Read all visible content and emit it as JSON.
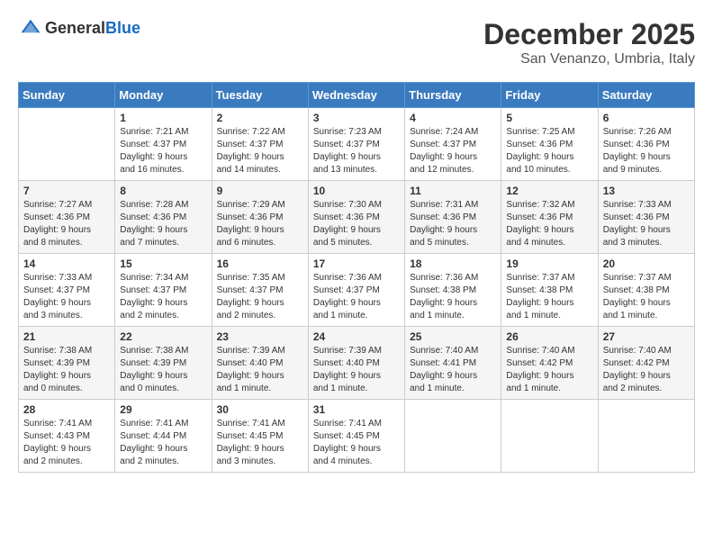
{
  "header": {
    "logo_general": "General",
    "logo_blue": "Blue",
    "month_title": "December 2025",
    "location": "San Venanzo, Umbria, Italy"
  },
  "weekdays": [
    "Sunday",
    "Monday",
    "Tuesday",
    "Wednesday",
    "Thursday",
    "Friday",
    "Saturday"
  ],
  "weeks": [
    [
      {
        "day": "",
        "info": ""
      },
      {
        "day": "1",
        "info": "Sunrise: 7:21 AM\nSunset: 4:37 PM\nDaylight: 9 hours\nand 16 minutes."
      },
      {
        "day": "2",
        "info": "Sunrise: 7:22 AM\nSunset: 4:37 PM\nDaylight: 9 hours\nand 14 minutes."
      },
      {
        "day": "3",
        "info": "Sunrise: 7:23 AM\nSunset: 4:37 PM\nDaylight: 9 hours\nand 13 minutes."
      },
      {
        "day": "4",
        "info": "Sunrise: 7:24 AM\nSunset: 4:37 PM\nDaylight: 9 hours\nand 12 minutes."
      },
      {
        "day": "5",
        "info": "Sunrise: 7:25 AM\nSunset: 4:36 PM\nDaylight: 9 hours\nand 10 minutes."
      },
      {
        "day": "6",
        "info": "Sunrise: 7:26 AM\nSunset: 4:36 PM\nDaylight: 9 hours\nand 9 minutes."
      }
    ],
    [
      {
        "day": "7",
        "info": "Sunrise: 7:27 AM\nSunset: 4:36 PM\nDaylight: 9 hours\nand 8 minutes."
      },
      {
        "day": "8",
        "info": "Sunrise: 7:28 AM\nSunset: 4:36 PM\nDaylight: 9 hours\nand 7 minutes."
      },
      {
        "day": "9",
        "info": "Sunrise: 7:29 AM\nSunset: 4:36 PM\nDaylight: 9 hours\nand 6 minutes."
      },
      {
        "day": "10",
        "info": "Sunrise: 7:30 AM\nSunset: 4:36 PM\nDaylight: 9 hours\nand 5 minutes."
      },
      {
        "day": "11",
        "info": "Sunrise: 7:31 AM\nSunset: 4:36 PM\nDaylight: 9 hours\nand 5 minutes."
      },
      {
        "day": "12",
        "info": "Sunrise: 7:32 AM\nSunset: 4:36 PM\nDaylight: 9 hours\nand 4 minutes."
      },
      {
        "day": "13",
        "info": "Sunrise: 7:33 AM\nSunset: 4:36 PM\nDaylight: 9 hours\nand 3 minutes."
      }
    ],
    [
      {
        "day": "14",
        "info": "Sunrise: 7:33 AM\nSunset: 4:37 PM\nDaylight: 9 hours\nand 3 minutes."
      },
      {
        "day": "15",
        "info": "Sunrise: 7:34 AM\nSunset: 4:37 PM\nDaylight: 9 hours\nand 2 minutes."
      },
      {
        "day": "16",
        "info": "Sunrise: 7:35 AM\nSunset: 4:37 PM\nDaylight: 9 hours\nand 2 minutes."
      },
      {
        "day": "17",
        "info": "Sunrise: 7:36 AM\nSunset: 4:37 PM\nDaylight: 9 hours\nand 1 minute."
      },
      {
        "day": "18",
        "info": "Sunrise: 7:36 AM\nSunset: 4:38 PM\nDaylight: 9 hours\nand 1 minute."
      },
      {
        "day": "19",
        "info": "Sunrise: 7:37 AM\nSunset: 4:38 PM\nDaylight: 9 hours\nand 1 minute."
      },
      {
        "day": "20",
        "info": "Sunrise: 7:37 AM\nSunset: 4:38 PM\nDaylight: 9 hours\nand 1 minute."
      }
    ],
    [
      {
        "day": "21",
        "info": "Sunrise: 7:38 AM\nSunset: 4:39 PM\nDaylight: 9 hours\nand 0 minutes."
      },
      {
        "day": "22",
        "info": "Sunrise: 7:38 AM\nSunset: 4:39 PM\nDaylight: 9 hours\nand 0 minutes."
      },
      {
        "day": "23",
        "info": "Sunrise: 7:39 AM\nSunset: 4:40 PM\nDaylight: 9 hours\nand 1 minute."
      },
      {
        "day": "24",
        "info": "Sunrise: 7:39 AM\nSunset: 4:40 PM\nDaylight: 9 hours\nand 1 minute."
      },
      {
        "day": "25",
        "info": "Sunrise: 7:40 AM\nSunset: 4:41 PM\nDaylight: 9 hours\nand 1 minute."
      },
      {
        "day": "26",
        "info": "Sunrise: 7:40 AM\nSunset: 4:42 PM\nDaylight: 9 hours\nand 1 minute."
      },
      {
        "day": "27",
        "info": "Sunrise: 7:40 AM\nSunset: 4:42 PM\nDaylight: 9 hours\nand 2 minutes."
      }
    ],
    [
      {
        "day": "28",
        "info": "Sunrise: 7:41 AM\nSunset: 4:43 PM\nDaylight: 9 hours\nand 2 minutes."
      },
      {
        "day": "29",
        "info": "Sunrise: 7:41 AM\nSunset: 4:44 PM\nDaylight: 9 hours\nand 2 minutes."
      },
      {
        "day": "30",
        "info": "Sunrise: 7:41 AM\nSunset: 4:45 PM\nDaylight: 9 hours\nand 3 minutes."
      },
      {
        "day": "31",
        "info": "Sunrise: 7:41 AM\nSunset: 4:45 PM\nDaylight: 9 hours\nand 4 minutes."
      },
      {
        "day": "",
        "info": ""
      },
      {
        "day": "",
        "info": ""
      },
      {
        "day": "",
        "info": ""
      }
    ]
  ]
}
